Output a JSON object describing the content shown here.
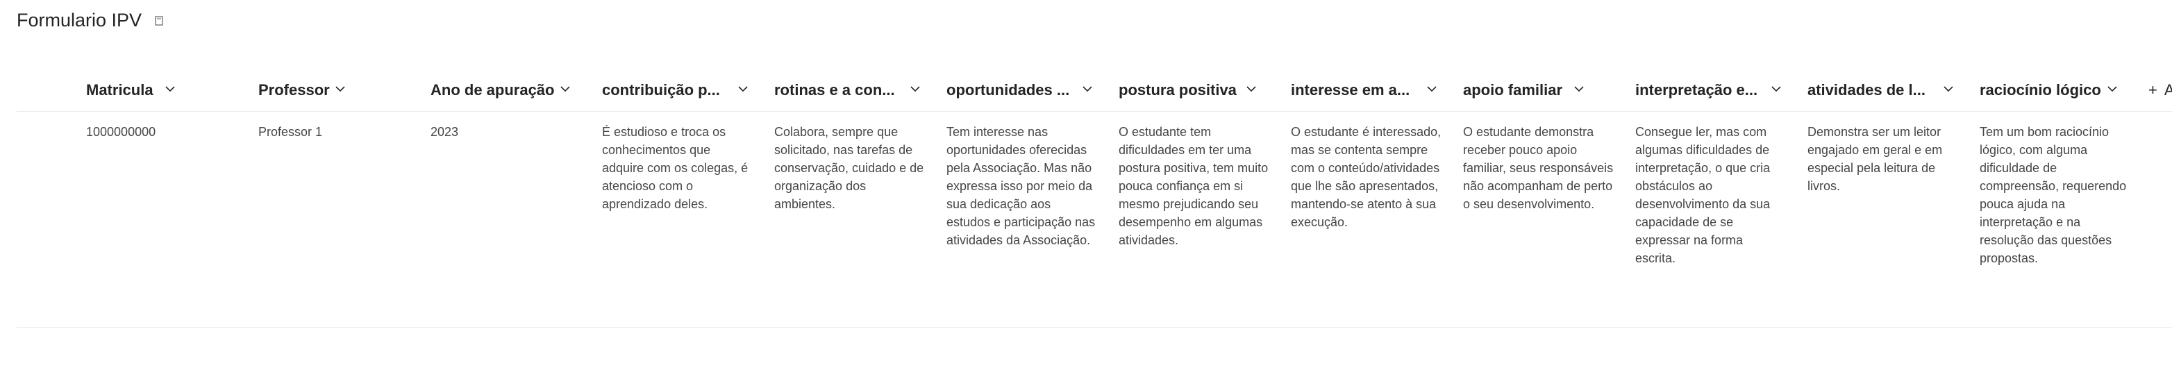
{
  "list": {
    "title": "Formulario IPV",
    "view_icon": "view-options-icon"
  },
  "columns": [
    {
      "label": "Matricula"
    },
    {
      "label": "Professor"
    },
    {
      "label": "Ano de apuração"
    },
    {
      "label": "contribuição p..."
    },
    {
      "label": "rotinas e a con..."
    },
    {
      "label": "oportunidades ..."
    },
    {
      "label": "postura positiva"
    },
    {
      "label": "interesse em a..."
    },
    {
      "label": "apoio familiar"
    },
    {
      "label": "interpretação e..."
    },
    {
      "label": "atividades de l..."
    },
    {
      "label": "raciocínio lógico"
    }
  ],
  "add_column": {
    "label": "A"
  },
  "rows": [
    {
      "cells": [
        "1000000000",
        "Professor 1",
        "2023",
        "É estudioso e troca os conhecimentos que adquire com os colegas, é atencioso com o aprendizado deles.",
        "Colabora, sempre que solicitado, nas tarefas de conservação, cuidado e de organização dos ambientes.",
        "Tem interesse nas oportunidades oferecidas pela Associação. Mas não expressa isso por meio da sua dedicação aos estudos e participação nas atividades da Associação.",
        "O estudante tem dificuldades em ter uma postura positiva, tem muito pouca confiança em si mesmo prejudicando seu desempenho em algumas atividades.",
        "O estudante é interessado, mas se contenta sempre com o conteúdo/atividades que lhe são apresentados, mantendo-se atento à sua execução.",
        "O estudante demonstra receber pouco apoio familiar, seus responsáveis não acompanham de perto o seu desenvolvimento.",
        "Consegue ler, mas com algumas dificuldades de interpretação, o que cria obstáculos ao desenvolvimento da sua capacidade de se expressar na forma escrita.",
        "Demonstra ser um leitor engajado em geral e em especial pela leitura de livros.",
        "Tem um bom raciocínio lógico, com alguma dificuldade de compreensão, requerendo pouca ajuda na interpretação e na resolução das questões propostas."
      ]
    }
  ]
}
